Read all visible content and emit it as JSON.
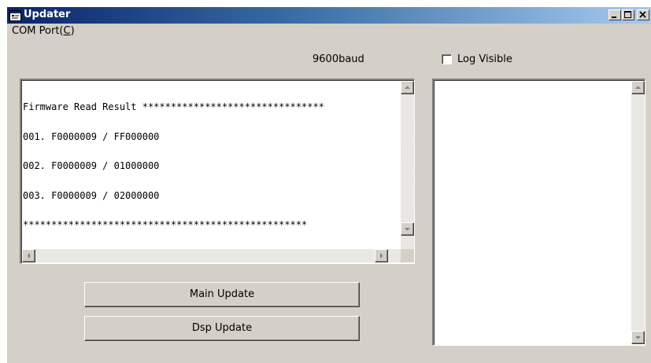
{
  "window": {
    "title": "Updater",
    "icon": "app-window-icon",
    "controls": [
      "minimize",
      "maximize",
      "close"
    ]
  },
  "menu": {
    "com_port_prefix": "COM Port(",
    "com_port_accel": "C",
    "com_port_suffix": ")"
  },
  "baud_label": "9600baud",
  "log_visible": {
    "label": "Log Visible",
    "checked": false
  },
  "result_box": {
    "lines": [
      "Firmware Read Result ********************************",
      "001. F0000009 / FF000000",
      "002. F0000009 / 01000000",
      "003. F0000009 / 02000000",
      "**************************************************"
    ]
  },
  "log_box": {
    "lines": []
  },
  "buttons": {
    "main_update": "Main Update",
    "dsp_update": "Dsp Update"
  },
  "colors": {
    "face": "#d4d0c8",
    "title_active_start": "#0a246a",
    "title_active_end": "#a6caf0"
  }
}
